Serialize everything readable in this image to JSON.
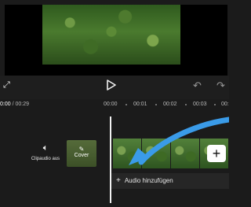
{
  "toolbar": {
    "fullscreen_icon": "fullscreen-icon",
    "play_icon": "play-icon",
    "undo_icon": "undo-icon",
    "redo_icon": "redo-icon"
  },
  "timeline": {
    "current_time": "0:00",
    "total_time": "/ 00:29",
    "ticks": [
      "00:00",
      "00:01",
      "00:02",
      "00:03",
      "00:"
    ]
  },
  "track": {
    "clipaudio_label": "Clipaudio aus",
    "cover_label": "Cover",
    "add_audio_label": "Audio hinzufügen"
  },
  "colors": {
    "background": "#1b1b1b",
    "annotation_arrow": "#3a9be8"
  }
}
